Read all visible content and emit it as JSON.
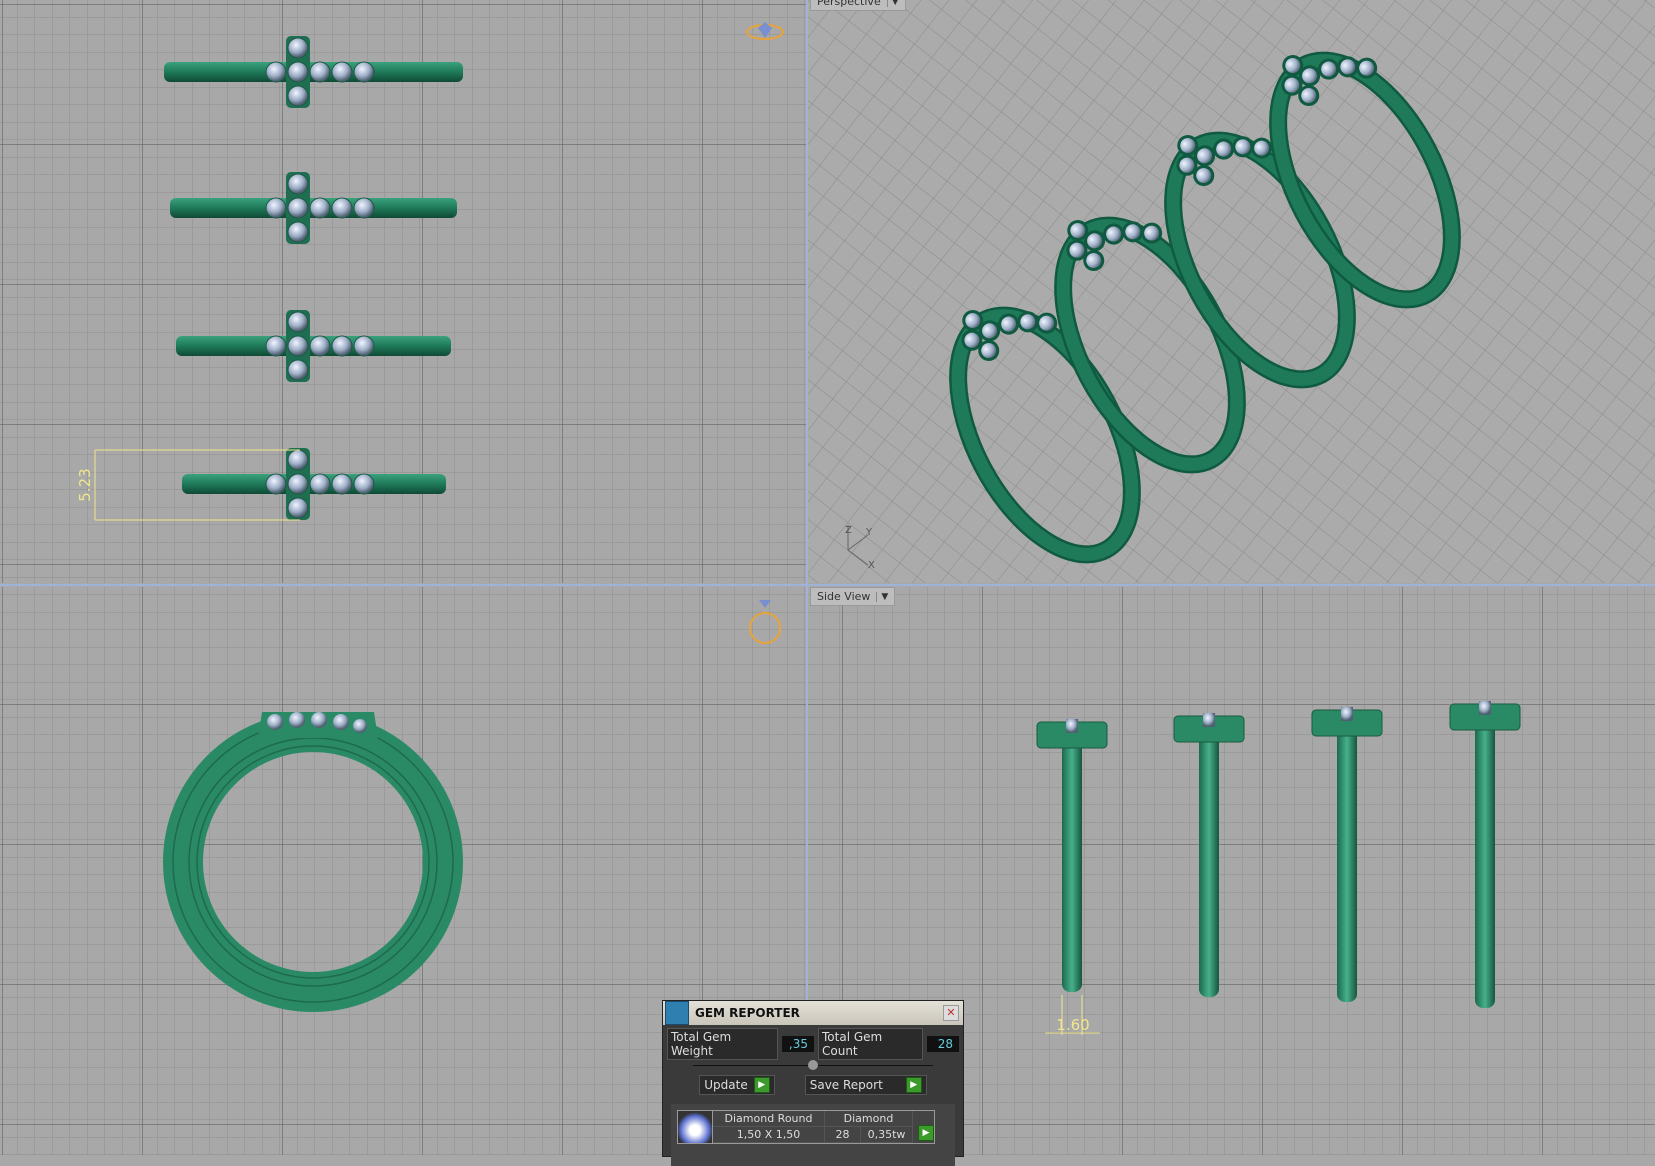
{
  "viewports": {
    "top_left": {
      "dimension": "5.23"
    },
    "top_right": {
      "label": "Perspective"
    },
    "bottom_left": {},
    "bottom_right": {
      "label": "Side View",
      "dimension": "1.60"
    }
  },
  "axis": {
    "z": "Z",
    "y": "Y",
    "x": "X"
  },
  "colors": {
    "metal": "#1f7a5a",
    "grid_bg": "#a8a8a8",
    "dimension": "#f0e68c",
    "viewport_border": "#9fb3d9"
  },
  "gem_reporter": {
    "title": "GEM REPORTER",
    "total_weight_label": "Total Gem Weight",
    "total_weight_value": ",35",
    "total_count_label": "Total Gem Count",
    "total_count_value": "28",
    "update_label": "Update",
    "save_report_label": "Save Report",
    "rows": [
      {
        "shape": "Diamond Round",
        "material": "Diamond",
        "size": "1,50 X 1,50",
        "count": "28",
        "weight": "0,35tw"
      }
    ]
  }
}
